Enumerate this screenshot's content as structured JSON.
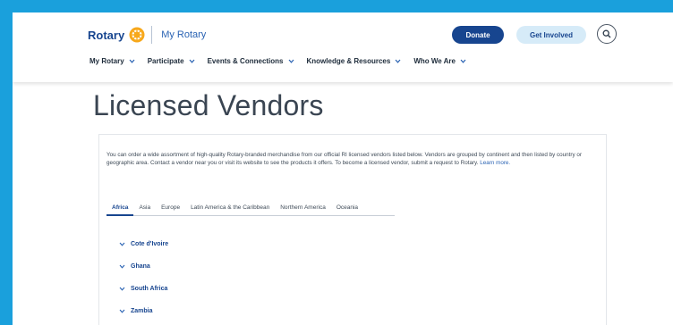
{
  "header": {
    "logo_text": "Rotary",
    "my_rotary": "My Rotary",
    "donate_label": "Donate",
    "get_involved_label": "Get Involved",
    "search_icon": "search-icon"
  },
  "nav": {
    "items": [
      {
        "label": "My Rotary"
      },
      {
        "label": "Participate"
      },
      {
        "label": "Events & Connections"
      },
      {
        "label": "Knowledge & Resources"
      },
      {
        "label": "Who We Are"
      }
    ]
  },
  "main": {
    "title": "Licensed Vendors",
    "intro_text": "You can order a wide assortment of high-quality Rotary-branded merchandise from our official RI licensed vendors listed below. Vendors are grouped by continent and then listed by country or geographic area. Contact a vendor near you or visit its website to see the products it offers. To become a licensed vendor, submit a request to Rotary.",
    "learn_more": "Learn more.",
    "tabs": [
      {
        "label": "Africa",
        "active": true
      },
      {
        "label": "Asia"
      },
      {
        "label": "Europe"
      },
      {
        "label": "Latin America & the Caribbean"
      },
      {
        "label": "Northern America"
      },
      {
        "label": "Oceania"
      }
    ],
    "regions": [
      {
        "label": "Cote d'Ivoire"
      },
      {
        "label": "Ghana"
      },
      {
        "label": "South Africa"
      },
      {
        "label": "Zambia"
      }
    ]
  },
  "colors": {
    "frame_border": "#1aa0dc",
    "brand_blue": "#17458f",
    "gold": "#f7a81b",
    "light_blue_button": "#d6ebf8"
  }
}
